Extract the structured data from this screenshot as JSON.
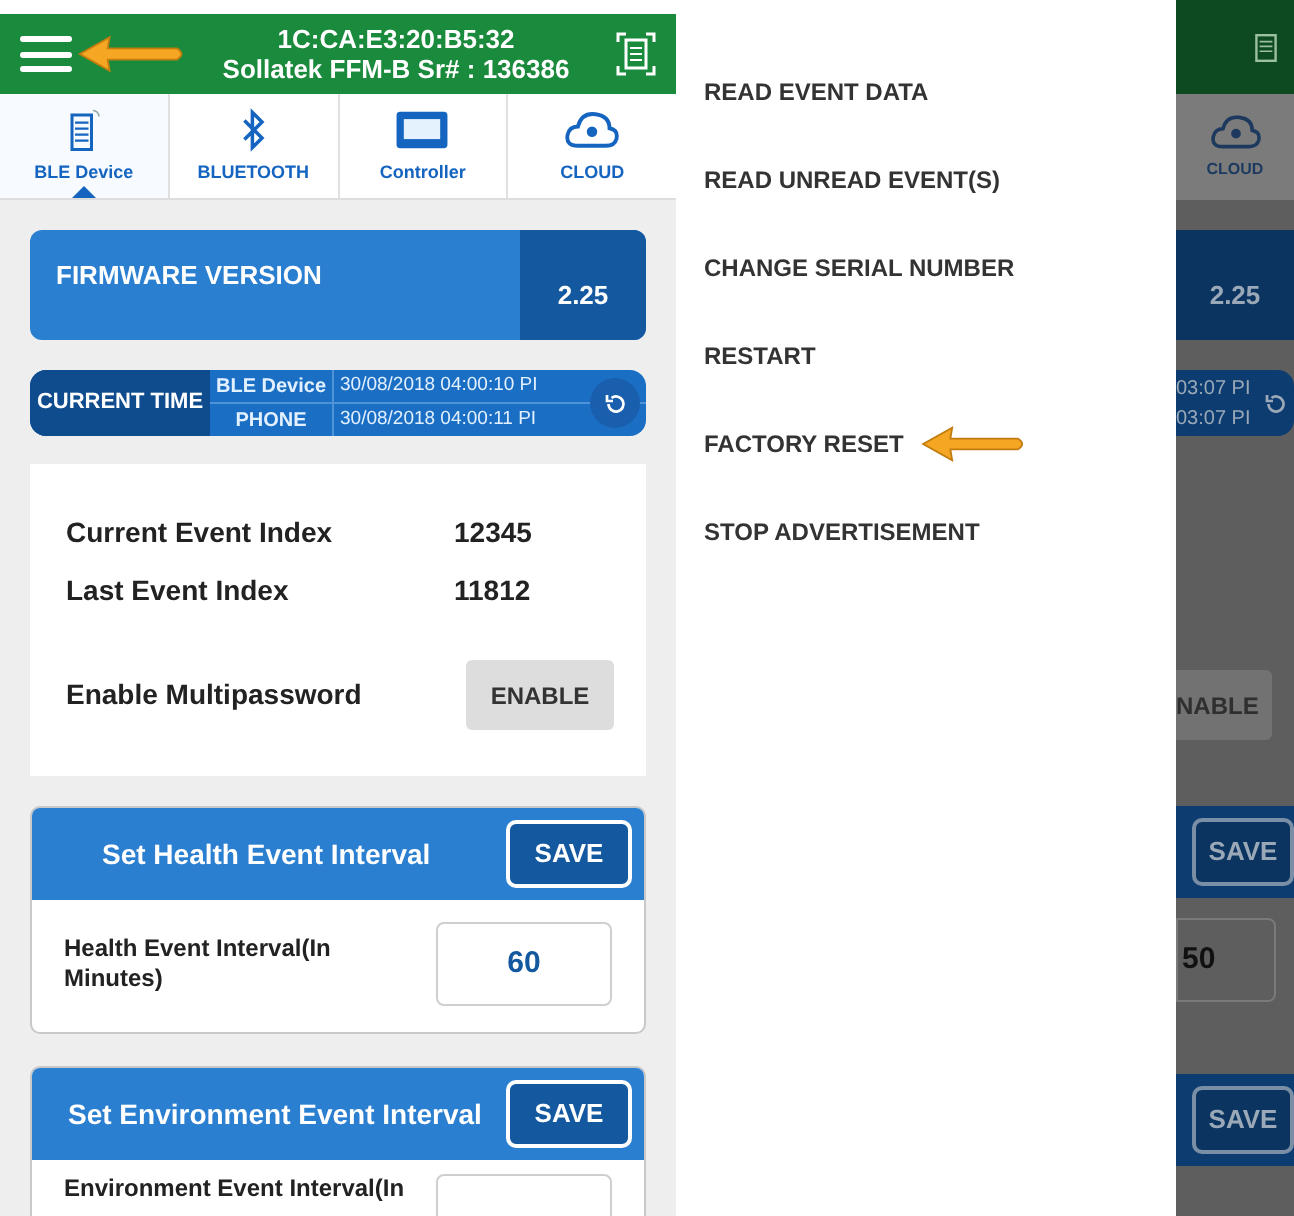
{
  "header": {
    "mac": "1C:CA:E3:20:B5:32",
    "device": "Sollatek FFM-B Sr# : 136386",
    "pointer": true
  },
  "tabs": [
    {
      "label": "BLE Device",
      "selected": true,
      "kind": "device"
    },
    {
      "label": "BLUETOOTH",
      "selected": false,
      "kind": "bluetooth"
    },
    {
      "label": "Controller",
      "selected": false,
      "kind": "controller"
    },
    {
      "label": "CLOUD",
      "selected": false,
      "kind": "cloud"
    }
  ],
  "firmware": {
    "label": "FIRMWARE VERSION",
    "value": "2.25"
  },
  "current_time": {
    "label": "CURRENT TIME",
    "rows": [
      {
        "source": "BLE Device",
        "time": "30/08/2018 04:00:10 PI"
      },
      {
        "source": "PHONE",
        "time": "30/08/2018 04:00:11 PI"
      }
    ]
  },
  "event_index": [
    {
      "label": "Current Event Index",
      "value": "12345"
    },
    {
      "label": "Last Event Index",
      "value": "11812"
    }
  ],
  "multipassword": {
    "label": "Enable Multipassword",
    "button": "ENABLE"
  },
  "intervals": [
    {
      "title": "Set Health Event Interval",
      "button": "SAVE",
      "field_label": "Health Event Interval(In Minutes)",
      "value": "60"
    },
    {
      "title": "Set Environment Event Interval",
      "button": "SAVE",
      "field_label": "Environment Event Interval(In"
    }
  ],
  "drawer": {
    "items": [
      {
        "label": "READ EVENT DATA",
        "pointer": false
      },
      {
        "label": "READ UNREAD EVENT(S)",
        "pointer": false
      },
      {
        "label": "CHANGE SERIAL NUMBER",
        "pointer": false
      },
      {
        "label": "RESTART",
        "pointer": false
      },
      {
        "label": "FACTORY RESET",
        "pointer": true
      },
      {
        "label": "STOP ADVERTISEMENT",
        "pointer": false
      }
    ]
  },
  "background_screen": {
    "tab": "CLOUD",
    "firmware_value": "2.25",
    "times": [
      "03:07 PI",
      "03:07 PI"
    ],
    "button": "NABLE",
    "saves": [
      "SAVE",
      "SAVE"
    ],
    "value": "50"
  }
}
